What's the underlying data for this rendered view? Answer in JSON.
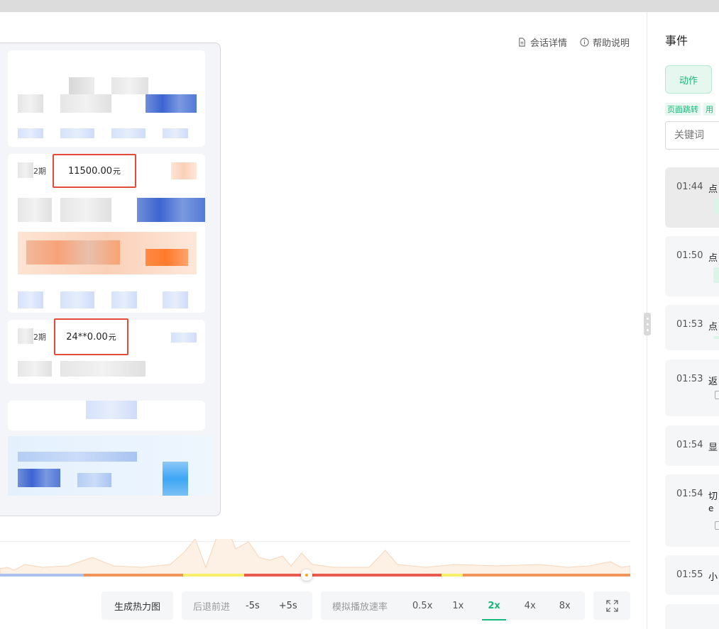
{
  "header": {
    "session_details": "会话详情",
    "help": "帮助说明"
  },
  "preview": {
    "bill1": {
      "period": "2期",
      "amount": "11500.00",
      "unit": "元"
    },
    "bill2": {
      "period": "2期",
      "amount": "24**0.00",
      "unit": "元"
    }
  },
  "controls": {
    "heatmap": "生成热力图",
    "seek_label": "后退前进",
    "back": "-5s",
    "forward": "+5s",
    "speed_label": "模拟播放速率",
    "speeds": [
      "0.5x",
      "1x",
      "2x",
      "4x",
      "8x"
    ],
    "active_speed": "2x",
    "fullscreen_icon": "expand-icon"
  },
  "panel": {
    "title": "事件",
    "action_button": "动作",
    "tags": [
      "页面跳转",
      "用"
    ],
    "keyword_placeholder": "关键词",
    "events": [
      {
        "time": "01:44",
        "text": "点"
      },
      {
        "time": "01:50",
        "text": "点"
      },
      {
        "time": "01:53",
        "text": "点"
      },
      {
        "time": "01:53",
        "text": "返"
      },
      {
        "time": "01:54",
        "text": "显"
      },
      {
        "time": "01:54",
        "text": "切",
        "sub": "e"
      },
      {
        "time": "01:55",
        "text": "小"
      }
    ]
  },
  "colors": {
    "accent": "#17b87a",
    "highlight_box": "#e34c3b",
    "timeline_orange": "#f0955a",
    "timeline_red": "#e85a4f",
    "timeline_yellow": "#f7f06b",
    "timeline_blue": "#a9c1ef"
  }
}
